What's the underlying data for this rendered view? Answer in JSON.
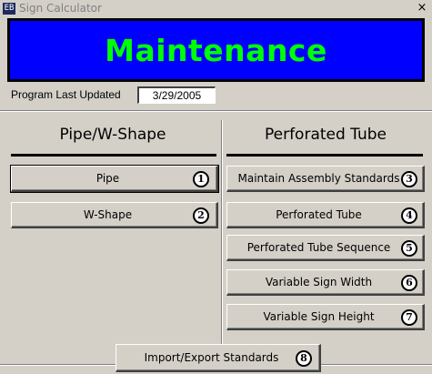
{
  "window": {
    "title": "Sign Calculator",
    "app_icon": "form-icon",
    "app_icon_glyph": "EB",
    "close_glyph": "×"
  },
  "banner": {
    "text": "Maintenance",
    "background": "#0000ff",
    "text_color": "#00ff00"
  },
  "program": {
    "label": "Program Last Updated",
    "value": "3/29/2005"
  },
  "left_section": {
    "header": "Pipe/W-Shape",
    "buttons": [
      {
        "label": "Pipe",
        "number": "1"
      },
      {
        "label": "W-Shape",
        "number": "2"
      }
    ]
  },
  "right_section": {
    "header": "Perforated Tube",
    "buttons": [
      {
        "label": "Maintain Assembly Standards",
        "number": "3"
      },
      {
        "label": "Perforated Tube",
        "number": "4"
      },
      {
        "label": "Perforated Tube Sequence",
        "number": "5"
      },
      {
        "label": "Variable Sign Width",
        "number": "6"
      },
      {
        "label": "Variable Sign Height",
        "number": "7"
      }
    ]
  },
  "footer": {
    "button": {
      "label": "Import/Export Standards",
      "number": "8"
    }
  }
}
